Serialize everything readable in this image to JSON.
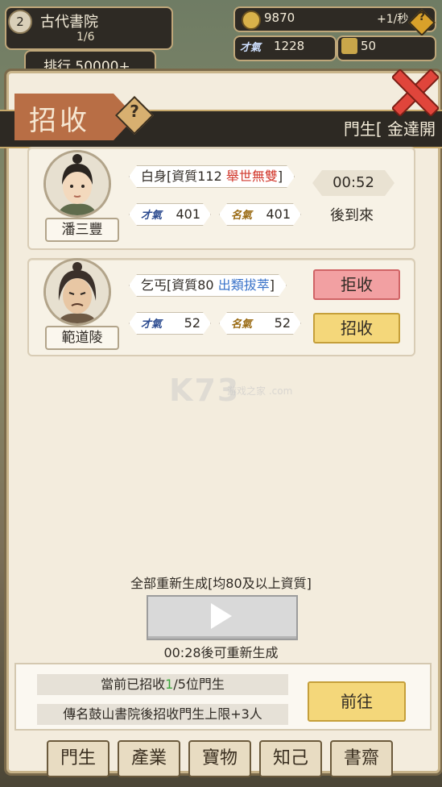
{
  "top_bar": {
    "school_level": "2",
    "school_name": "古代書院",
    "school_progress": "1/6",
    "rank": "排行 50000+",
    "coins": "9870",
    "coin_rate": "+1/秒",
    "talent": "1228",
    "fame": "50"
  },
  "panel": {
    "title": "招收",
    "disciple_label": "門生[ 金達開"
  },
  "candidates": [
    {
      "name": "潘三豐",
      "origin": "白身[資質112",
      "grade": "舉世無雙",
      "close": "]",
      "talent": "401",
      "fame": "401",
      "timer": "00:52",
      "status": "後到來"
    },
    {
      "name": "範道陵",
      "origin": "乞丐[資質80",
      "grade": "出類拔萃",
      "close": "]",
      "talent": "52",
      "fame": "52",
      "reject_label": "拒收",
      "accept_label": "招收"
    }
  ],
  "stat_icons": {
    "talent": "才氣",
    "fame": "名氣"
  },
  "regen": {
    "label": "全部重新生成[均80及以上資質]",
    "timer": "00:28後可重新生成"
  },
  "footer": {
    "row1_prefix": "當前已招收",
    "row1_count": "1",
    "row1_suffix": "/5位門生",
    "row2": "傳名鼓山書院後招收門生上限+3人",
    "goto_label": "前往"
  },
  "bottom_tabs": [
    "門生",
    "產業",
    "寶物",
    "知己",
    "書齋"
  ],
  "watermark": {
    "main": "K73",
    "sub": "游戏之家 .com"
  },
  "colors": {
    "accent_red": "#d23a2e",
    "accent_blue": "#3a73c9",
    "accent_green": "#3aa63a",
    "accept_yellow": "#f4d77a",
    "reject_pink": "#f2a0a2"
  }
}
